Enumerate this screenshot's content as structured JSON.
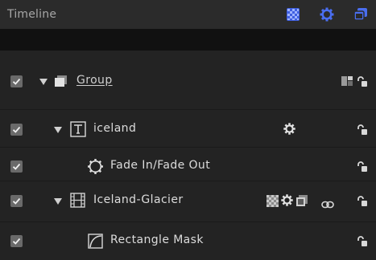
{
  "panel": {
    "title": "Timeline",
    "header_icons": [
      "checker-filter-icon",
      "gear-filter-icon",
      "layers-filter-icon"
    ],
    "accent_color": "#4a6ef0"
  },
  "rows": [
    {
      "label": "Group",
      "type": "group",
      "icon": "group-icon",
      "expanded": true,
      "checked": true
    },
    {
      "label": "iceland",
      "type": "text-layer",
      "icon": "text-layer-icon",
      "expanded": true,
      "checked": true
    },
    {
      "label": "Fade In/Fade Out",
      "type": "behavior",
      "icon": "behavior-gear-icon",
      "checked": true
    },
    {
      "label": "Iceland-Glacier",
      "type": "media-layer",
      "icon": "film-icon",
      "expanded": true,
      "checked": true
    },
    {
      "label": "Rectangle Mask",
      "type": "mask",
      "icon": "mask-icon",
      "checked": true
    }
  ]
}
